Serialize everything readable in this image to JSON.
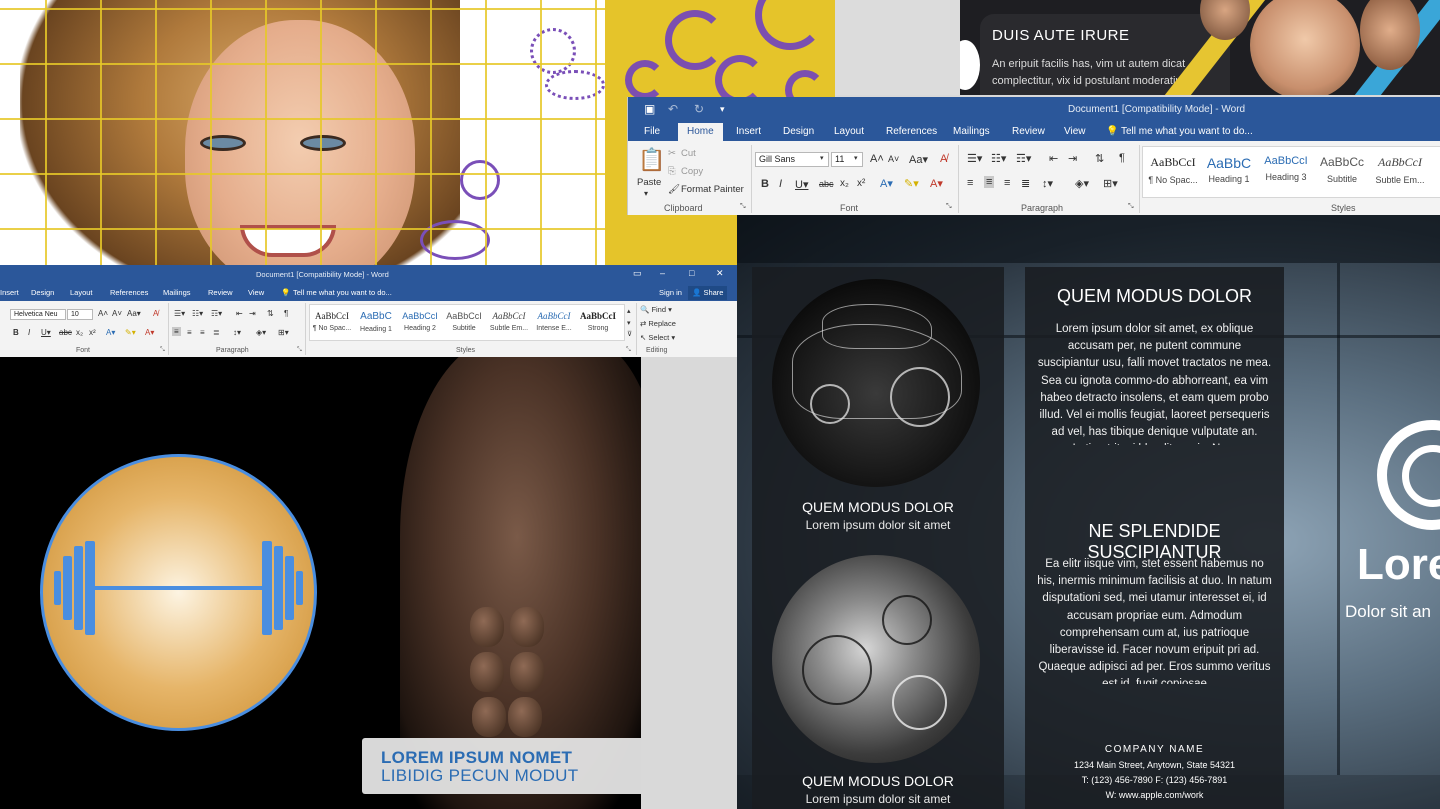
{
  "dark_panel": {
    "title": "DUIS AUTE IRURE",
    "body": "An eripuit facilis has, vim ut autem dicat complectitur, vix id postulant moderatius"
  },
  "word_large": {
    "title": "Document1 [Compatibility Mode] - Word",
    "tabs": [
      "File",
      "Home",
      "Insert",
      "Design",
      "Layout",
      "References",
      "Mailings",
      "Review",
      "View"
    ],
    "tell_me": "Tell me what you want to do...",
    "clipboard": {
      "paste": "Paste",
      "cut": "Cut",
      "copy": "Copy",
      "format_painter": "Format Painter",
      "label": "Clipboard"
    },
    "font": {
      "name": "Gill Sans",
      "size": "11",
      "label": "Font"
    },
    "paragraph_label": "Paragraph",
    "styles_label": "Styles",
    "styles": [
      {
        "sample": "AaBbCcI",
        "name": "¶ No Spac..."
      },
      {
        "sample": "AaBbC",
        "name": "Heading 1"
      },
      {
        "sample": "AaBbCcI",
        "name": "Heading 3"
      },
      {
        "sample": "AaBbCc",
        "name": "Subtitle"
      },
      {
        "sample": "AaBbCcI",
        "name": "Subtle Em..."
      }
    ]
  },
  "word_small": {
    "title": "Document1 [Compatibility Mode] - Word",
    "tabs": [
      "Insert",
      "Design",
      "Layout",
      "References",
      "Mailings",
      "Review",
      "View"
    ],
    "tell_me": "Tell me what you want to do...",
    "sign_in": "Sign in",
    "share": "Share",
    "font": {
      "name": "Helvetica Neu",
      "size": "10",
      "label": "Font"
    },
    "paragraph_label": "Paragraph",
    "styles_label": "Styles",
    "editing_label": "Editing",
    "editing": {
      "find": "Find",
      "replace": "Replace",
      "select": "Select"
    },
    "styles": [
      {
        "sample": "AaBbCcI",
        "name": "¶ No Spac..."
      },
      {
        "sample": "AaBbC",
        "name": "Heading 1"
      },
      {
        "sample": "AaBbCcI",
        "name": "Heading 2"
      },
      {
        "sample": "AaBbCcI",
        "name": "Subtitle"
      },
      {
        "sample": "AaBbCcI",
        "name": "Subtle Em..."
      },
      {
        "sample": "AaBbCcI",
        "name": "Intense E..."
      },
      {
        "sample": "AaBbCcI",
        "name": "Strong"
      }
    ]
  },
  "gym": {
    "caption_line1": "LOREM IPSUM NOMET",
    "caption_line2": "LIBIDIG PECUN MODUT"
  },
  "brochure": {
    "car_title": "QUEM MODUS DOLOR",
    "car_sub": "Lorem ipsum dolor sit amet",
    "engine_title": "QUEM MODUS DOLOR",
    "engine_sub": "Lorem ipsum dolor sit amet",
    "heading1": "QUEM MODUS DOLOR",
    "body1": "Lorem ipsum dolor sit amet, ex oblique accusam per, ne putent commune suscipiantur usu, falli movet tractatos ne mea. Sea cu ignota commo-do abhorreant, ea vim habeo detracto insolens, et eam quem probo illud. Vel ei mollis feugiat, laoreet persequeris ad vel, has tibique denique vulputate an. Latine tritani blandit an vis. Nam",
    "heading2": "NE SPLENDIDE SUSCIPIANTUR",
    "body2": "Ea elitr iisque vim, stet essent habemus no his, inermis minimum facilisis at duo. In natum disputationi sed, mei utamur interesset ei, id accusam propriae eum. Admodum comprehensam cum at, ius patrioque liberavisse id. Facer novum eripuit pri ad. Quaeque adipisci ad per. Eros summo veritus est id, fugit copiosae",
    "company_name": "COMPANY NAME",
    "address": "1234 Main Street, Anytown, State 54321",
    "phone": "T: (123) 456-7890 F: (123) 456-7891",
    "web": "W: www.apple.com/work",
    "logo_text": "Lore",
    "logo_sub": "Dolor sit an"
  }
}
